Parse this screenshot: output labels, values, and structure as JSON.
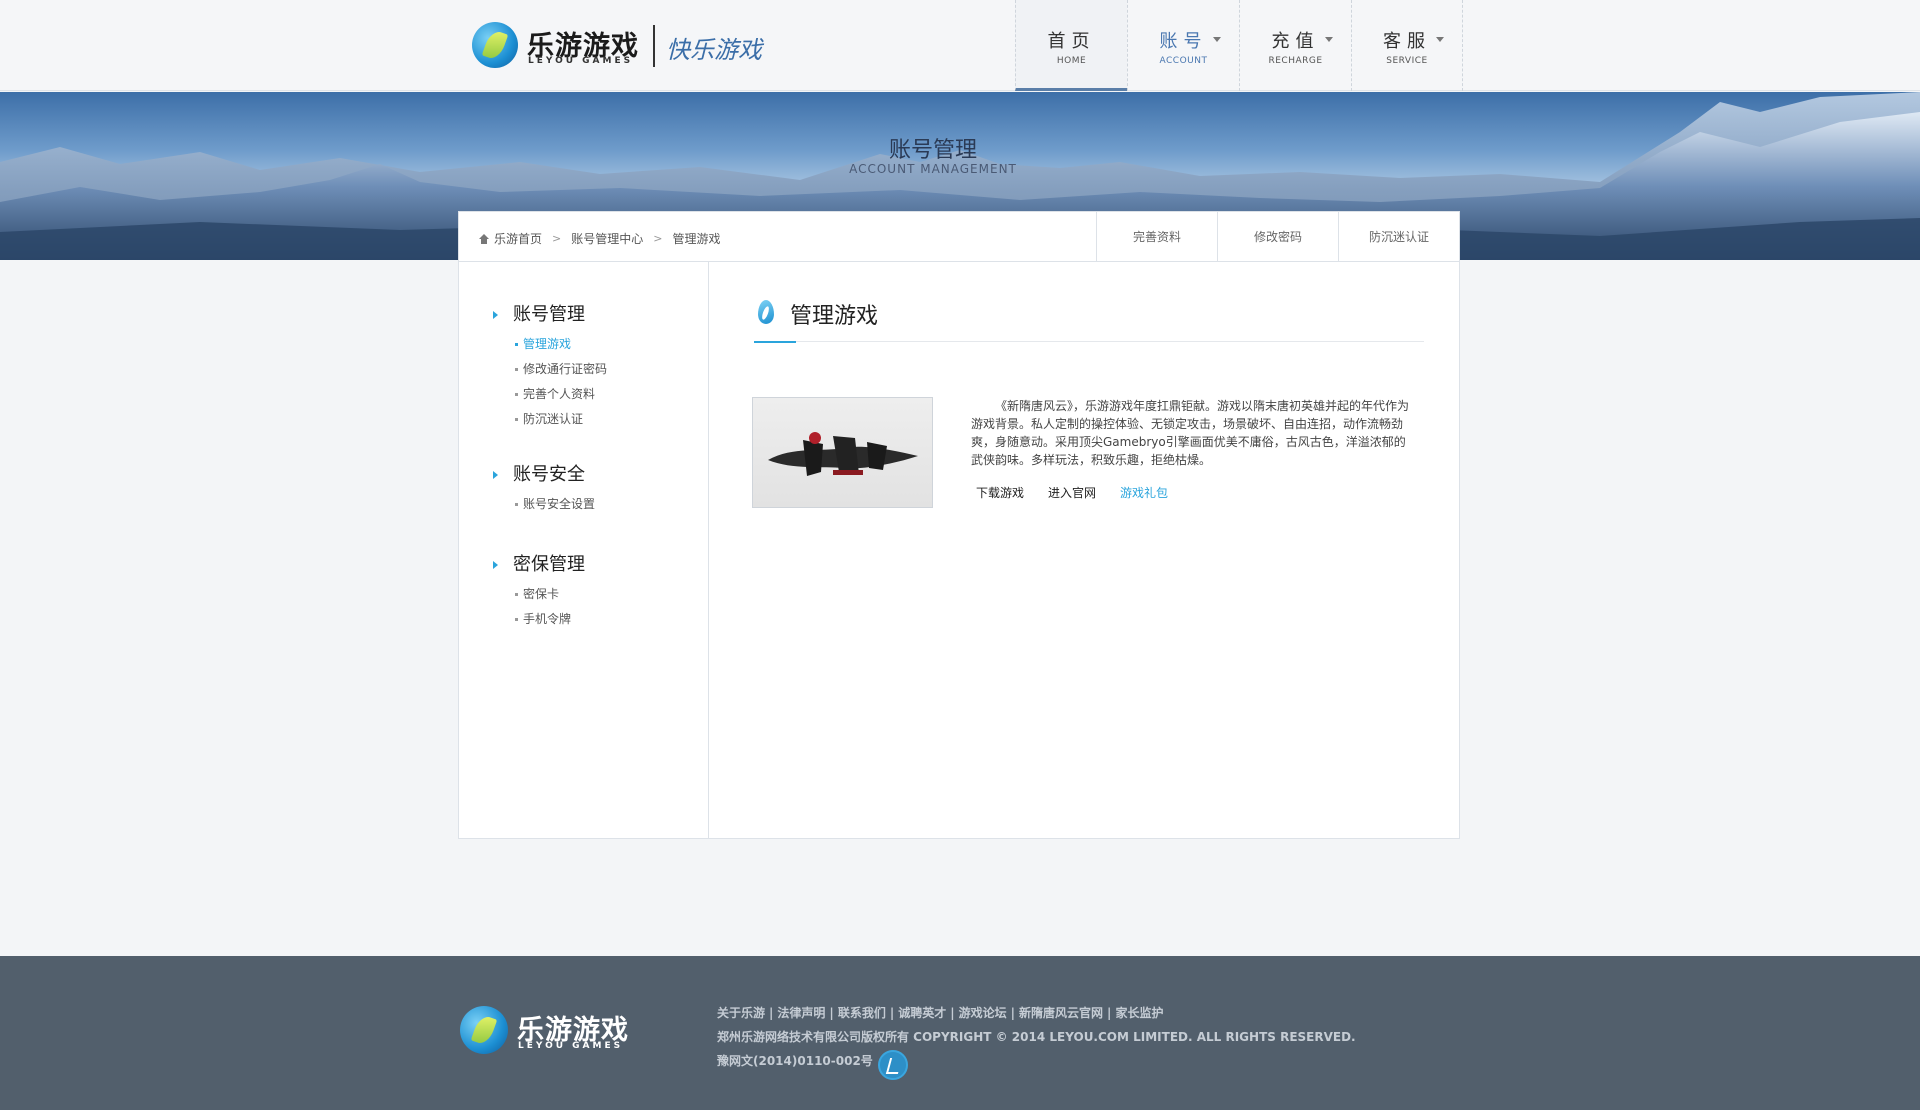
{
  "header": {
    "logo": {
      "cn": "乐游游戏",
      "en": "LEYOU GAMES",
      "slogan": "快乐游戏"
    },
    "nav": [
      {
        "cn": "首页",
        "en": "HOME",
        "active": true
      },
      {
        "cn": "账号",
        "en": "ACCOUNT",
        "current": true
      },
      {
        "cn": "充值",
        "en": "RECHARGE"
      },
      {
        "cn": "客服",
        "en": "SERVICE"
      }
    ]
  },
  "banner": {
    "title": "账号管理",
    "subtitle": "ACCOUNT MANAGEMENT"
  },
  "breadcrumb": {
    "home": "乐游首页",
    "center": "账号管理中心",
    "current": "管理游戏",
    "separator": ">"
  },
  "tabs": [
    "完善资料",
    "修改密码",
    "防沉迷认证"
  ],
  "sidebar": {
    "groups": [
      {
        "title": "账号管理",
        "items": [
          "管理游戏",
          "修改通行证密码",
          "完善个人资料",
          "防沉迷认证"
        ]
      },
      {
        "title": "账号安全",
        "items": [
          "账号安全设置"
        ]
      },
      {
        "title": "密保管理",
        "items": [
          "密保卡",
          "手机令牌"
        ]
      }
    ]
  },
  "content": {
    "title": "管理游戏",
    "game": {
      "description": "《新隋唐风云》，乐游游戏年度扛鼎钜献。游戏以隋末唐初英雄并起的年代作为游戏背景。私人定制的操控体验、无锁定攻击，场景破坏、自由连招，动作流畅劲爽，身随意动。采用顶尖Gamebryo引擎画面优美不庸俗，古风古色，洋溢浓郁的武侠韵味。多样玩法，积致乐趣，拒绝枯燥。",
      "links": [
        "下载游戏",
        "进入官网",
        "游戏礼包"
      ]
    }
  },
  "footer": {
    "logo": {
      "cn": "乐游游戏",
      "en": "LEYOU GAMES"
    },
    "links": [
      "关于乐游",
      "法律声明",
      "联系我们",
      "诚聘英才",
      "游戏论坛",
      "新隋唐风云官网",
      "家长监护"
    ],
    "copyright": "郑州乐游网络技术有限公司版权所有 COPYRIGHT © 2014 LEYOU.COM LIMITED. ALL RIGHTS RESERVED.",
    "icp": "豫网文(2014)0110-002号"
  },
  "colors": {
    "accent": "#2aa4dc",
    "nav_current": "#4a77b0",
    "footer_bg": "#525f6c"
  }
}
